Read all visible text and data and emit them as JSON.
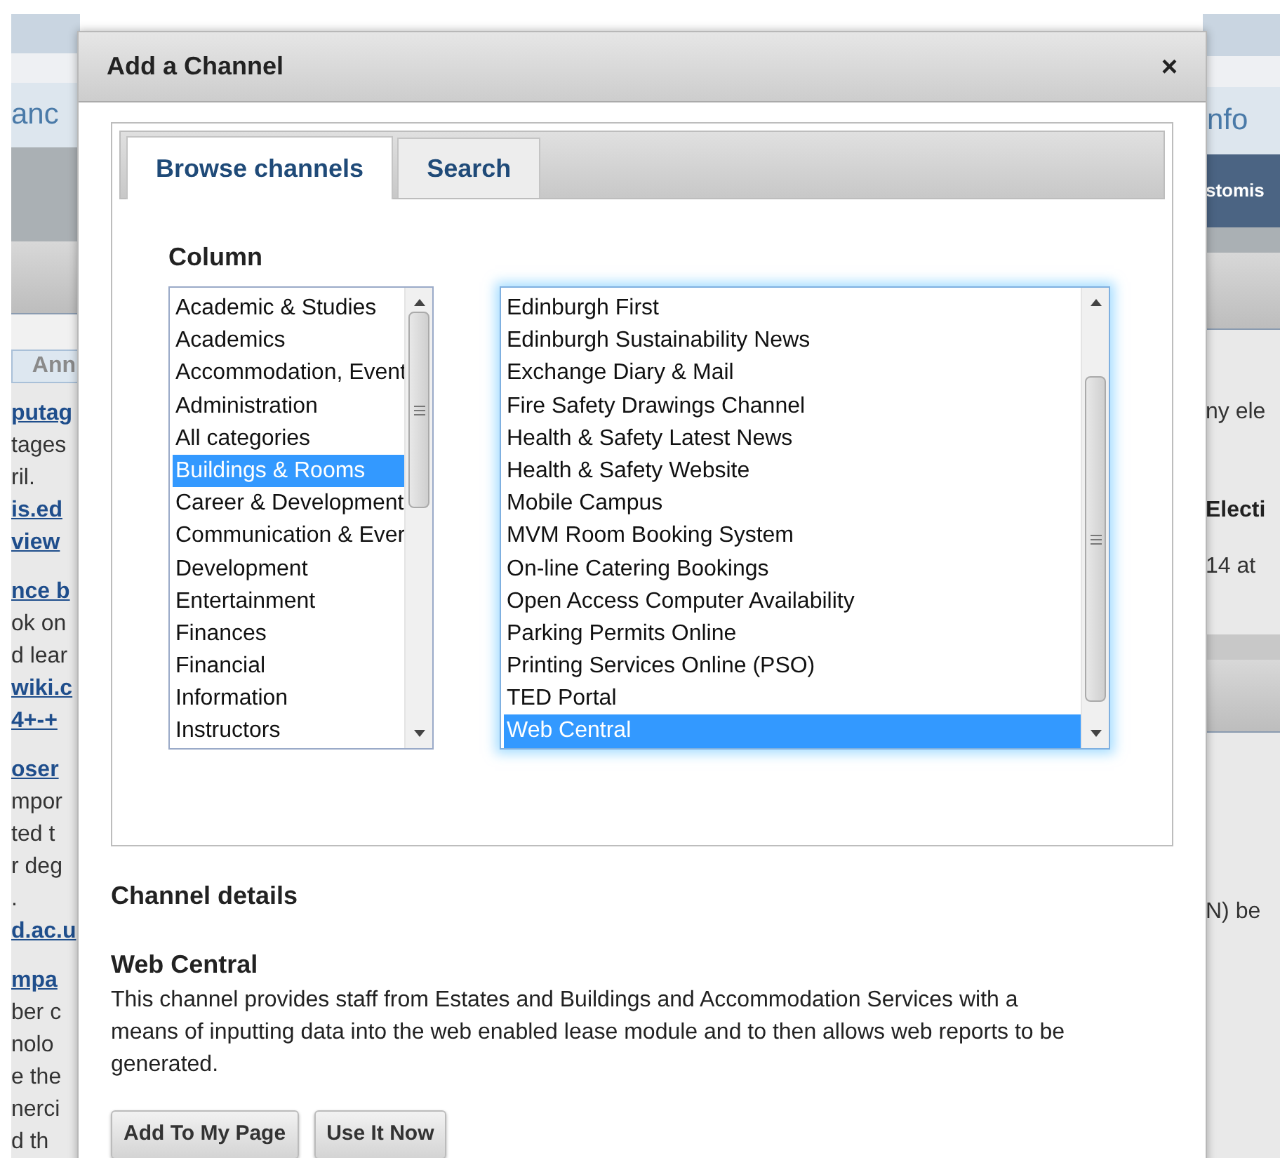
{
  "background": {
    "left_nav": "anc",
    "left_tab": "Ann",
    "left_blocks": [
      [
        {
          "text": "putag",
          "kind": "link"
        },
        {
          "text": "tages",
          "kind": "text"
        },
        {
          "text": "ril.",
          "kind": "text"
        },
        {
          "text": "is.ed",
          "kind": "link"
        },
        {
          "text": "view",
          "kind": "link"
        }
      ],
      [
        {
          "text": "nce b",
          "kind": "link"
        },
        {
          "text": "ok on",
          "kind": "text"
        },
        {
          "text": "d lear",
          "kind": "text"
        },
        {
          "text": "wiki.c",
          "kind": "link"
        },
        {
          "text": "4+-+",
          "kind": "link"
        }
      ],
      [
        {
          "text": "oser",
          "kind": "link"
        },
        {
          "text": "mpor",
          "kind": "text"
        },
        {
          "text": "ted t",
          "kind": "text"
        },
        {
          "text": "r deg",
          "kind": "text"
        },
        {
          "text": ".",
          "kind": "text"
        },
        {
          "text": "d.ac.u",
          "kind": "link"
        }
      ],
      [
        {
          "text": "mpa",
          "kind": "link"
        },
        {
          "text": "ber c",
          "kind": "text"
        },
        {
          "text": "nolo",
          "kind": "text"
        },
        {
          "text": "e the",
          "kind": "text"
        },
        {
          "text": "nerci",
          "kind": "text"
        },
        {
          "text": "d th",
          "kind": "text"
        }
      ]
    ],
    "right_nav": "nfo",
    "right_bar": "stomis",
    "right_block_1": [
      {
        "text": "ny ele",
        "kind": "text"
      },
      {
        "text": "Electi",
        "kind": "bold"
      },
      {
        "text": "14 at",
        "kind": "text"
      }
    ],
    "right_block_2": [
      "N) be"
    ]
  },
  "dialog": {
    "title": "Add a Channel",
    "close": "×",
    "tabs": [
      {
        "label": "Browse channels",
        "selected": true
      },
      {
        "label": "Search",
        "selected": false
      }
    ],
    "column_label": "Column",
    "categories": [
      {
        "label": "Academic & Studies",
        "selected": false
      },
      {
        "label": "Academics",
        "selected": false
      },
      {
        "label": "Accommodation, Event",
        "selected": false
      },
      {
        "label": "Administration",
        "selected": false
      },
      {
        "label": "All categories",
        "selected": false
      },
      {
        "label": "Buildings & Rooms",
        "selected": true
      },
      {
        "label": "Career & Development",
        "selected": false
      },
      {
        "label": "Communication & Ever",
        "selected": false
      },
      {
        "label": "Development",
        "selected": false
      },
      {
        "label": "Entertainment",
        "selected": false
      },
      {
        "label": "Finances",
        "selected": false
      },
      {
        "label": "Financial",
        "selected": false
      },
      {
        "label": "Information",
        "selected": false
      },
      {
        "label": "Instructors",
        "selected": false
      }
    ],
    "channels": [
      {
        "label": "Edinburgh First",
        "selected": false
      },
      {
        "label": "Edinburgh Sustainability News",
        "selected": false
      },
      {
        "label": "Exchange Diary & Mail",
        "selected": false
      },
      {
        "label": "Fire Safety Drawings Channel",
        "selected": false
      },
      {
        "label": "Health & Safety Latest News",
        "selected": false
      },
      {
        "label": "Health & Safety Website",
        "selected": false
      },
      {
        "label": "Mobile Campus",
        "selected": false
      },
      {
        "label": "MVM Room Booking System",
        "selected": false
      },
      {
        "label": "On-line Catering Bookings",
        "selected": false
      },
      {
        "label": "Open Access Computer Availability",
        "selected": false
      },
      {
        "label": "Parking Permits Online",
        "selected": false
      },
      {
        "label": "Printing Services Online (PSO)",
        "selected": false
      },
      {
        "label": "TED Portal",
        "selected": false
      },
      {
        "label": "Web Central",
        "selected": true
      }
    ],
    "details_heading": "Channel details",
    "channel_name": "Web Central",
    "description": "This channel provides staff from Estates and Buildings and Accommodation Services with a means of inputting data into the web enabled lease module and to then allows web reports to be generated.",
    "buttons": [
      "Add To My Page",
      "Use It Now"
    ]
  }
}
